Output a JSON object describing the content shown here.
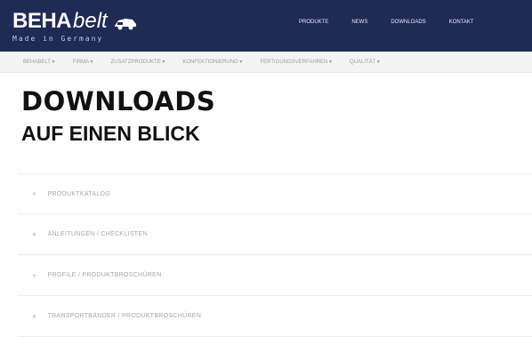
{
  "header": {
    "logo": {
      "brand_bold": "BEHA",
      "brand_italic": "belt",
      "tagline": "Made in Germany"
    },
    "nav": [
      "PRODUKTE",
      "NEWS",
      "DOWNLOADS",
      "KONTAKT"
    ]
  },
  "subnav": {
    "items": [
      "BEHABELT ▾",
      "FIRMA ▾",
      "ZUSATZPRODUKTE ▾",
      "KONFEKTIONIERUNG ▾",
      "FERTIGUNGSVERFAHREN ▾",
      "QUALITÄT ▾"
    ]
  },
  "page": {
    "title_line1": "DOWNLOADS",
    "title_line2": "AUF EINEN BLICK"
  },
  "downloads": {
    "items": [
      {
        "label": "PRODUKTKATALOG"
      },
      {
        "label": "ANLEITUNGEN / CHECKLISTEN"
      },
      {
        "label": "PROFILE / PRODUKTBROSCHÜREN"
      },
      {
        "label": "TRANSPORTBÄNDER / PRODUKTBROSCHÜREN"
      }
    ],
    "toggle_symbol": "+"
  },
  "colors": {
    "header_bg": "#1f2a55",
    "subnav_bg": "#f4f4f4",
    "headline": "#111111",
    "list_text": "#a8a8a8"
  }
}
